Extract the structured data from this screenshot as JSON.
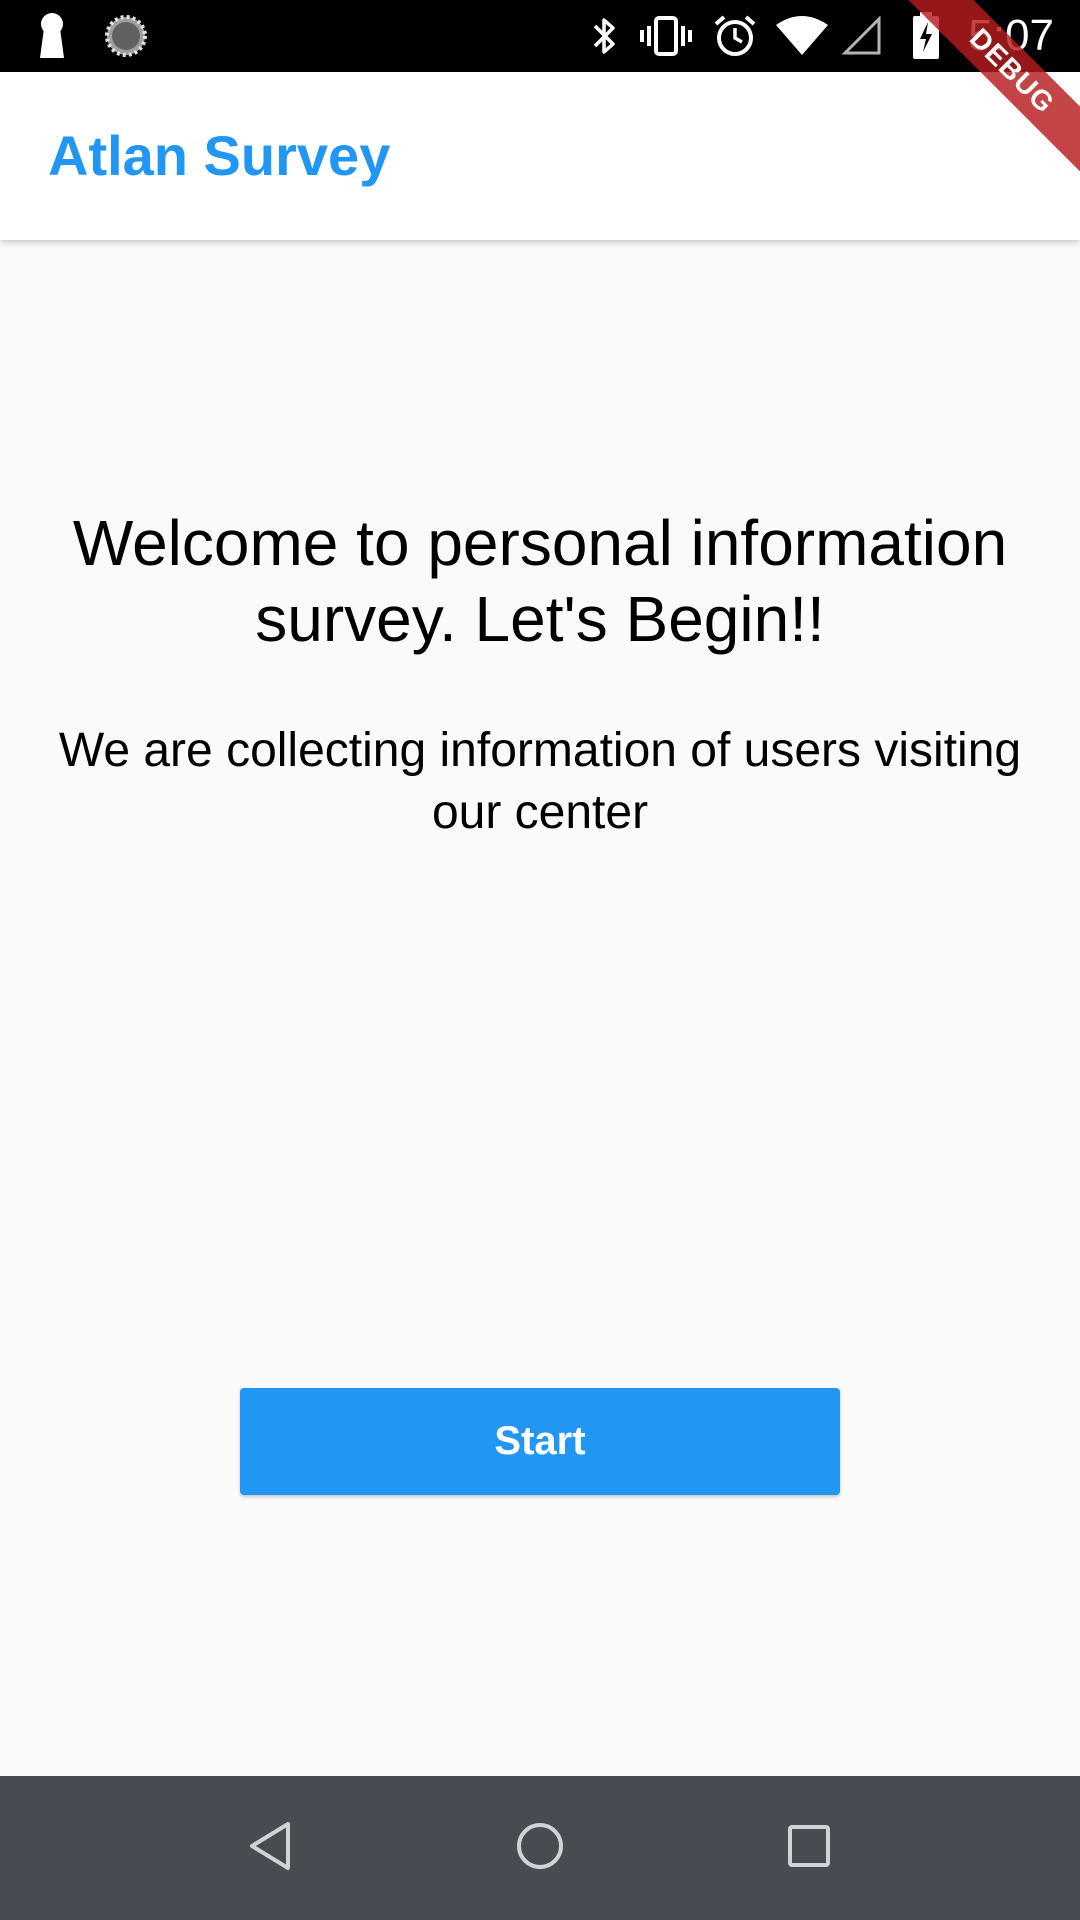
{
  "status_bar": {
    "time": "5:07",
    "left_icons": [
      "keyhole-icon",
      "loading-spinner-icon"
    ],
    "right_icons": [
      "bluetooth-icon",
      "vibrate-icon",
      "alarm-icon",
      "wifi-icon",
      "cellular-signal-icon",
      "battery-charging-icon"
    ]
  },
  "app_bar": {
    "title": "Atlan Survey",
    "title_color": "#2196f3"
  },
  "debug_banner": {
    "label": "DEBUG",
    "color": "#b71c1c"
  },
  "content": {
    "heading": "Welcome to personal information survey. Let's Begin!!",
    "subheading": "We are collecting information of users visiting our center",
    "start_button_label": "Start",
    "accent_color": "#2196f3"
  },
  "nav_bar": {
    "buttons": [
      "back-icon",
      "home-icon",
      "recents-icon"
    ]
  }
}
